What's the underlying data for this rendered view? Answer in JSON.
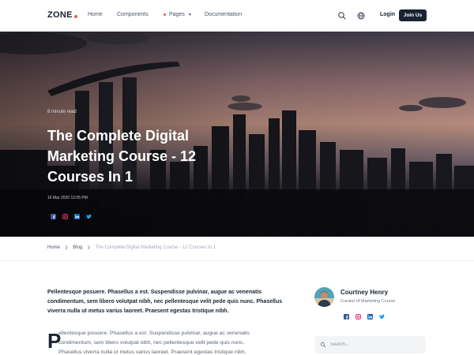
{
  "colors": {
    "accent": "#ef5a3c",
    "navy": "#1a2332",
    "text": "#1b2433",
    "muted": "#5b6575",
    "facebook": "#3b5998",
    "instagram": "#e1306c",
    "linkedin": "#0a66c2",
    "twitter": "#1da1f2"
  },
  "navbar": {
    "logo": "ZONE",
    "links": {
      "home": "Home",
      "components": "Components",
      "pages": "Pages",
      "documentation": "Documentation"
    },
    "icons": [
      "search-icon",
      "globe-icon"
    ],
    "login": "Login",
    "join": "Join Us"
  },
  "hero": {
    "meta": "8 minute read",
    "title": "The Complete Digital Marketing Course - 12 Courses In 1",
    "date": "16 Mar 2020 12:05 PM",
    "social": [
      "facebook-icon",
      "instagram-icon",
      "linkedin-icon",
      "twitter-icon"
    ]
  },
  "breadcrumb": {
    "home": "Home",
    "blog": "Blog",
    "current": "The Complete Digital Marketing Course - 12 Courses In 1"
  },
  "article": {
    "lead": "Pellentesque posuere. Phasellus a est. Suspendisse pulvinar, augue ac venenatis condimentum, sem libero volutpat nibh, nec pellentesque velit pede quis nunc. Phasellus viverra nulla ut metus varius laoreet. Praesent egestas tristique nibh.",
    "dropcap": "P",
    "body_line1": "ellentesque posuere. Phasellus a est. Suspendisse pulvinar, augue ac venenatis",
    "body_line2": "condimentum, sem libero volutpat nibh, nec pellentesque velit pede quis nunc.",
    "body_line3": "Phasellus viverra nulla ut metus varius laoreet. Praesent egestas tristique nibh."
  },
  "sidebar": {
    "author_name": "Courtney Henry",
    "author_role": "Curator of Marketing Course",
    "social": [
      "facebook-icon",
      "instagram-icon",
      "linkedin-icon",
      "twitter-icon"
    ],
    "search_placeholder": "Search..."
  }
}
